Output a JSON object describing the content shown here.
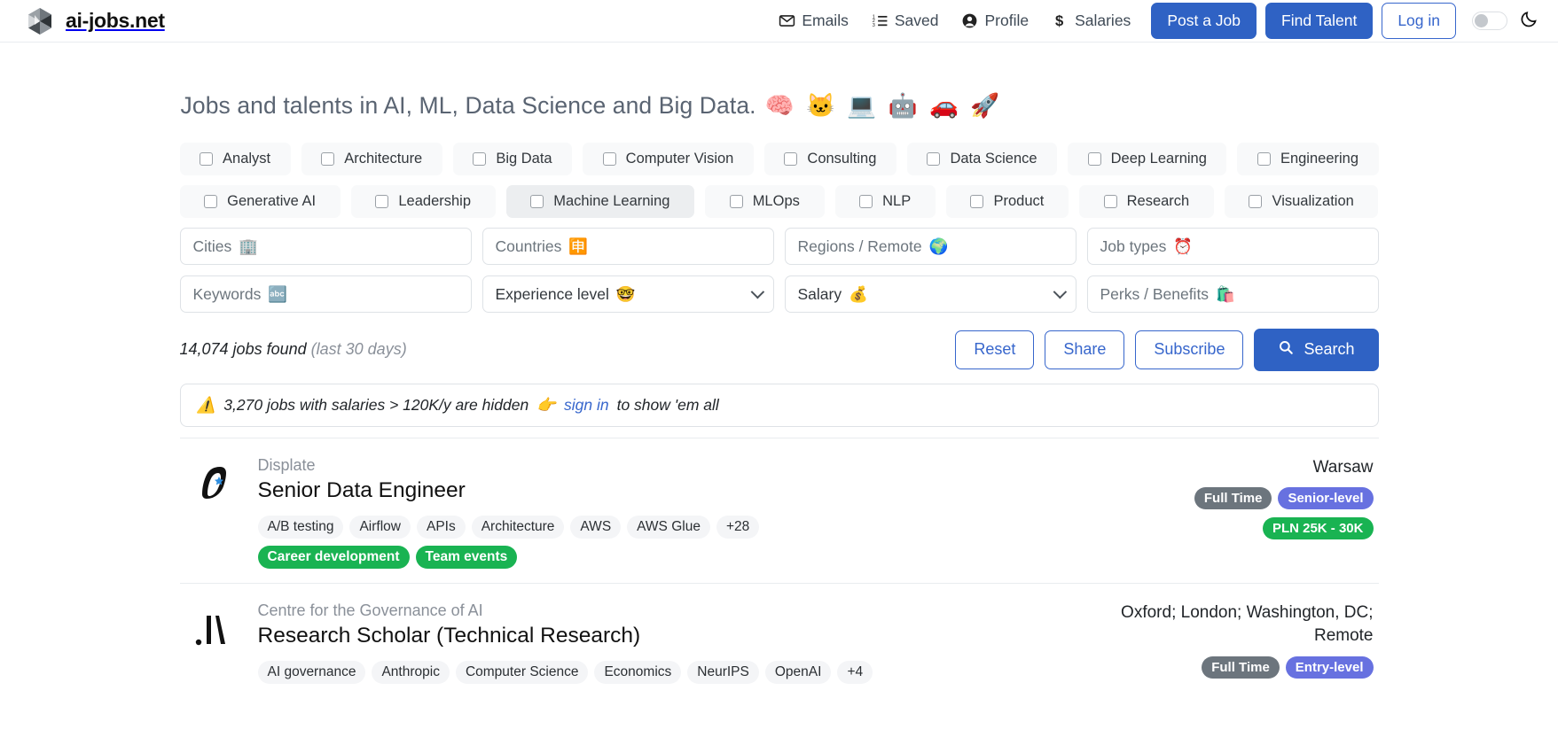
{
  "brand": {
    "name": "ai-jobs.net",
    "logo_icon": "hexagon-cube-logo"
  },
  "nav": {
    "links": [
      {
        "label": "Emails",
        "icon": "envelope-icon"
      },
      {
        "label": "Saved",
        "icon": "list-ol-icon"
      },
      {
        "label": "Profile",
        "icon": "user-circle-icon"
      },
      {
        "label": "Salaries",
        "icon": "dollar-icon"
      }
    ],
    "post_job": "Post a Job",
    "find_talent": "Find Talent",
    "log_in": "Log in",
    "theme_toggle_icon": "moon-icon",
    "theme_toggle_state": "off"
  },
  "headline": {
    "text": "Jobs and talents in AI, ML, Data Science and Big Data.",
    "emojis": "🧠 🐱 💻 🤖 🚗 🚀"
  },
  "categories": {
    "row1": [
      "Analyst",
      "Architecture",
      "Big Data",
      "Computer Vision",
      "Consulting",
      "Data Science",
      "Deep Learning",
      "Engineering"
    ],
    "row2": [
      "Generative AI",
      "Leadership",
      "Machine Learning",
      "MLOps",
      "NLP",
      "Product",
      "Research",
      "Visualization"
    ],
    "hovered": "Machine Learning"
  },
  "filters": {
    "cities": {
      "placeholder": "Cities",
      "emoji": "🏢",
      "value": ""
    },
    "countries": {
      "placeholder": "Countries",
      "emoji": "🈸",
      "value": ""
    },
    "regions": {
      "placeholder": "Regions / Remote",
      "emoji": "🌍",
      "value": ""
    },
    "job_types": {
      "placeholder": "Job types",
      "emoji": "⏰",
      "value": ""
    },
    "keywords": {
      "placeholder": "Keywords",
      "emoji": "🔤",
      "value": ""
    },
    "experience": {
      "placeholder": "Experience level",
      "emoji": "🤓",
      "value": ""
    },
    "salary": {
      "placeholder": "Salary",
      "emoji": "💰",
      "value": ""
    },
    "perks": {
      "placeholder": "Perks / Benefits",
      "emoji": "🛍️",
      "value": ""
    }
  },
  "results": {
    "count_text": "14,074 jobs found",
    "period_text": "(last 30 days)",
    "reset": "Reset",
    "share": "Share",
    "subscribe": "Subscribe",
    "search": "Search",
    "search_icon": "magnifier-icon"
  },
  "alert": {
    "warning_icon": "⚠️",
    "text_before": "3,270 jobs with salaries > 120K/y are hidden",
    "pointer_icon": "👉",
    "link": "sign in",
    "text_after": "to show 'em all"
  },
  "jobs": [
    {
      "company": "Displate",
      "title": "Senior Data Engineer",
      "logo_icon": "displate-logo",
      "location": "Warsaw",
      "tags": [
        "A/B testing",
        "Airflow",
        "APIs",
        "Architecture",
        "AWS",
        "AWS Glue",
        "+28"
      ],
      "perks": [
        "Career development",
        "Team events"
      ],
      "job_type": "Full Time",
      "level": "Senior-level",
      "salary": "PLN 25K - 30K"
    },
    {
      "company": "Centre for the Governance of AI",
      "title": "Research Scholar (Technical Research)",
      "logo_icon": "govai-logo",
      "location": "Oxford; London; Washington, DC; Remote",
      "tags": [
        "AI governance",
        "Anthropic",
        "Computer Science",
        "Economics",
        "NeurIPS",
        "OpenAI",
        "+4"
      ],
      "perks": [],
      "job_type": "Full Time",
      "level": "Entry-level",
      "salary": ""
    }
  ],
  "colors": {
    "primary": "#2f62c4",
    "link": "#3766cc",
    "green": "#19b352",
    "purple": "#6771e0",
    "gray_badge": "#6c757d"
  }
}
